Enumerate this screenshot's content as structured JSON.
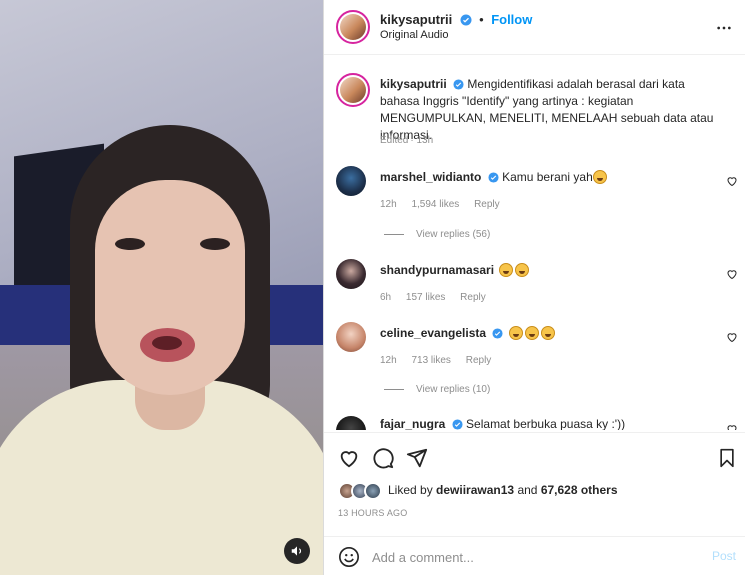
{
  "post": {
    "username": "kikysaputrii",
    "follow_label": "Follow",
    "audio": "Original Audio",
    "caption": "Mengidentifikasi adalah berasal dari kata bahasa Inggris \"Identify\" yang artinya : kegiatan MENGUMPULKAN, MENELITI, MENELAAH sebuah data atau informasi.",
    "edited": "Edited",
    "caption_time": "13h"
  },
  "comments": [
    {
      "username": "marshel_widianto",
      "text": "Kamu berani yah",
      "time": "12h",
      "likes": "1,594 likes",
      "reply": "Reply",
      "view_replies": "View replies (56)",
      "emoji_count": 1
    },
    {
      "username": "shandypurnamasari",
      "text": "",
      "time": "6h",
      "likes": "157 likes",
      "reply": "Reply",
      "view_replies": "",
      "emoji_count": 2
    },
    {
      "username": "celine_evangelista",
      "text": "",
      "time": "12h",
      "likes": "713 likes",
      "reply": "Reply",
      "view_replies": "View replies (10)",
      "emoji_count": 3
    },
    {
      "username": "fajar_nugra",
      "text": "Selamat berbuka puasa ky :'))",
      "time": "",
      "likes": "",
      "reply": "",
      "view_replies": "",
      "emoji_count": 0
    }
  ],
  "likes": {
    "prefix": "Liked by",
    "user": "dewiirawan13",
    "middle": "and",
    "others": "67,628 others"
  },
  "time_ago": "13 HOURS AGO",
  "add_comment": {
    "placeholder": "Add a comment...",
    "post_label": "Post"
  },
  "colors": {
    "accent": "#0095f6",
    "verified": "#3897f0",
    "muted": "#8e8e8e",
    "post_disabled": "#b2dffc"
  }
}
